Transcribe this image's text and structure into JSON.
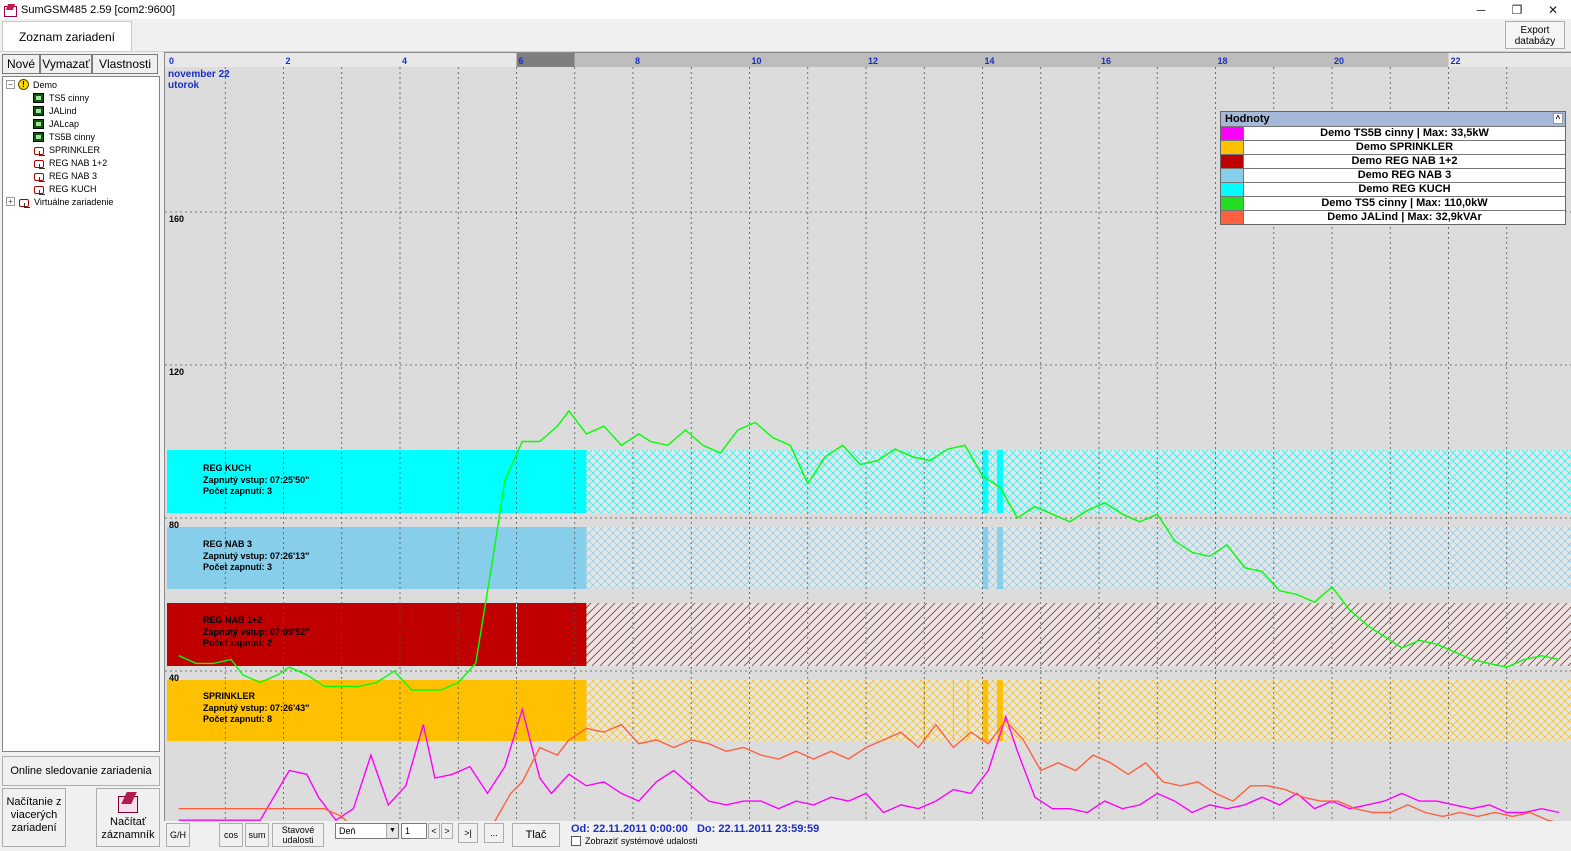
{
  "window": {
    "title": "SumGSM485 2.59 [com2:9600]",
    "minimize_glyph": "─",
    "restore_glyph": "❐",
    "close_glyph": "✕"
  },
  "toolbar": {
    "device_list_tab": "Zoznam zariadení",
    "export_line1": "Export",
    "export_line2": "databázy"
  },
  "left_panel": {
    "new_label": "Nové",
    "delete_label": "Vymazať",
    "properties_label": "Vlastnosti",
    "tree": {
      "root": "Demo",
      "expand_glyph": "−",
      "collapse_glyph": "+",
      "warning_glyph": "!",
      "children": [
        "TS5 cinny",
        "JALind",
        "JALcap",
        "TS5B cinny",
        "SPRINKLER",
        "REG NAB 1+2",
        "REG NAB 3",
        "REG KUCH"
      ],
      "child_icons": [
        "meter-icon",
        "meter-icon",
        "meter-icon",
        "meter-icon",
        "plug-icon",
        "plug-icon",
        "plug-icon",
        "plug-icon"
      ],
      "virtual": "Virtuálne zariadenie"
    },
    "online_label": "Online sledovanie zariadenia",
    "multi_line1": "Načítanie z",
    "multi_line2": "viacerých",
    "multi_line3": "zariadení",
    "record_line1": "Načítať",
    "record_line2": "záznamník"
  },
  "chart": {
    "header_date_line1": "november 22",
    "header_date_line2": "utorok",
    "colors": {
      "background": "#dcdcdc",
      "header_dark": "#7f7f7f",
      "ts5b": "#ff00ff",
      "sprinkler": "#ffc000",
      "reg_nab_12": "#c00000",
      "reg_nab_3": "#87ceeb",
      "reg_kuch": "#00ffff",
      "ts5": "#00ff00",
      "jalind": "#ff6040"
    },
    "bands": [
      {
        "name": "REG KUCH",
        "closed": "Zapnutý vstup: 07:25'50\"",
        "count": "Počet zapnutí: 3"
      },
      {
        "name": "REG NAB 3",
        "closed": "Zapnutý vstup: 07:26'13\"",
        "count": "Počet zapnutí: 3"
      },
      {
        "name": "REG NAB 1+2",
        "closed": "Zapnutý vstup: 07:09'52\"",
        "count": "Počet zapnutí: 2"
      },
      {
        "name": "SPRINKLER",
        "closed": "Zapnutý vstup: 07:26'43\"",
        "count": "Počet zapnutí: 8"
      }
    ],
    "legend": {
      "title": "Hodnoty",
      "close_glyph": "^",
      "rows": [
        {
          "label": "Demo TS5B cinny | Max: 33,5kW",
          "color": "#ff00ff"
        },
        {
          "label": "Demo SPRINKLER",
          "color": "#ffc000"
        },
        {
          "label": "Demo REG NAB 1+2",
          "color": "#c00000"
        },
        {
          "label": "Demo REG NAB 3",
          "color": "#87ceeb"
        },
        {
          "label": "Demo REG KUCH",
          "color": "#00ffff"
        },
        {
          "label": "Demo TS5 cinny | Max: 110,0kW",
          "color": "#22dd22"
        },
        {
          "label": "Demo JALind | Max: 32,9kVAr",
          "color": "#ff6040"
        }
      ]
    }
  },
  "chart_data": {
    "type": "line",
    "x_unit": "hour",
    "xlim": [
      0,
      24
    ],
    "x_ticks": [
      0,
      2,
      4,
      6,
      8,
      10,
      12,
      14,
      16,
      18,
      20,
      22
    ],
    "y_ticks": [
      40,
      80,
      120,
      160
    ],
    "grid": true,
    "legend_position": "top-right",
    "series": [
      {
        "name": "Demo TS5 cinny | Max: 110,0kW",
        "x": [
          0.2,
          0.5,
          0.8,
          1.1,
          1.3,
          1.6,
          1.9,
          2.1,
          2.4,
          2.7,
          3.0,
          3.3,
          3.6,
          3.9,
          4.2,
          4.4,
          4.7,
          5.0,
          5.3,
          5.6,
          5.8,
          6.1,
          6.4,
          6.7,
          6.9,
          7.2,
          7.5,
          7.8,
          8.1,
          8.3,
          8.6,
          8.9,
          9.2,
          9.5,
          9.8,
          10.1,
          10.4,
          10.7,
          11.0,
          11.3,
          11.6,
          11.9,
          12.2,
          12.5,
          12.8,
          13.1,
          13.4,
          13.7,
          14.0,
          14.3,
          14.6,
          14.9,
          15.2,
          15.5,
          15.8,
          16.1,
          16.4,
          16.7,
          17.0,
          17.3,
          17.6,
          17.9,
          18.2,
          18.5,
          18.8,
          19.1,
          19.4,
          19.7,
          20.0,
          20.3,
          20.6,
          20.9,
          21.2,
          21.5,
          21.8,
          22.1,
          22.4,
          22.7,
          23.0,
          23.3,
          23.6,
          23.9
        ],
        "values": [
          44,
          42,
          42,
          43,
          39,
          37,
          39,
          41,
          39,
          36,
          36,
          36,
          37,
          40,
          35,
          35,
          35,
          37,
          42,
          70,
          90,
          100,
          100,
          104,
          108,
          102,
          104,
          99,
          102,
          100,
          99,
          103,
          99,
          97,
          103,
          105,
          101,
          99,
          89,
          96,
          99,
          94,
          95,
          98,
          96,
          95,
          98,
          99,
          91,
          88,
          80,
          83,
          81,
          79,
          82,
          84,
          81,
          79,
          81,
          74,
          71,
          70,
          73,
          67,
          66,
          61,
          60,
          58,
          62,
          56,
          52,
          49,
          46,
          48,
          47,
          45,
          43,
          42,
          41,
          43,
          44,
          43
        ]
      },
      {
        "name": "Demo TS5B cinny | Max: 33,5kW",
        "x": [
          0.2,
          0.6,
          1.1,
          1.6,
          2.1,
          2.4,
          2.6,
          2.9,
          3.2,
          3.5,
          3.8,
          4.1,
          4.4,
          4.6,
          4.9,
          5.2,
          5.5,
          5.8,
          6.1,
          6.4,
          6.6,
          6.9,
          7.2,
          7.5,
          7.8,
          8.1,
          8.4,
          8.7,
          9.0,
          9.3,
          9.6,
          9.9,
          10.2,
          10.5,
          10.8,
          11.1,
          11.4,
          11.7,
          12.0,
          12.3,
          12.6,
          12.9,
          13.2,
          13.5,
          13.8,
          14.1,
          14.4,
          14.6,
          14.9,
          15.2,
          15.5,
          15.8,
          16.1,
          16.4,
          16.7,
          17.0,
          17.3,
          17.6,
          17.9,
          18.2,
          18.5,
          18.8,
          19.1,
          19.4,
          19.7,
          20.0,
          20.3,
          20.6,
          20.9,
          21.2,
          21.5,
          21.8,
          22.1,
          22.4,
          22.7,
          23.0,
          23.3,
          23.6,
          23.9
        ],
        "values": [
          1,
          1,
          1,
          1,
          14,
          13,
          7,
          1,
          4,
          18,
          5,
          10,
          26,
          12,
          13,
          15,
          8,
          15,
          30,
          12,
          8,
          13,
          10,
          11,
          8,
          6,
          11,
          14,
          10,
          6,
          5,
          6,
          6,
          4,
          6,
          5,
          7,
          6,
          8,
          3,
          5,
          4,
          6,
          9,
          8,
          14,
          28,
          19,
          7,
          4,
          4,
          3,
          6,
          4,
          5,
          8,
          6,
          3,
          5,
          4,
          5,
          7,
          5,
          8,
          4,
          6,
          4,
          5,
          6,
          8,
          6,
          6,
          5,
          4,
          5,
          3,
          3,
          4,
          3
        ]
      },
      {
        "name": "Demo JALind | Max: 32,9kVAr",
        "x": [
          0.2,
          0.8,
          1.6,
          2.4,
          2.7,
          3.0,
          3.3,
          3.6,
          4.0,
          4.4,
          4.7,
          5.0,
          5.3,
          5.6,
          5.9,
          6.1,
          6.4,
          6.7,
          6.9,
          7.2,
          7.5,
          7.8,
          8.1,
          8.4,
          8.7,
          9.0,
          9.3,
          9.6,
          9.9,
          10.2,
          10.5,
          10.8,
          11.1,
          11.4,
          11.7,
          12.0,
          12.3,
          12.6,
          12.9,
          13.2,
          13.5,
          13.8,
          14.1,
          14.4,
          14.7,
          15.0,
          15.3,
          15.6,
          15.9,
          16.2,
          16.5,
          16.8,
          17.1,
          17.4,
          17.7,
          18.0,
          18.3,
          18.6,
          18.9,
          19.2,
          19.5,
          19.8,
          20.1,
          20.4,
          20.7,
          21.0,
          21.3,
          21.6,
          21.9,
          22.2,
          22.5,
          22.8,
          23.1,
          23.4,
          23.7,
          24.0
        ],
        "values": [
          4,
          4,
          4,
          4,
          4,
          2,
          -3,
          -3,
          -3,
          -1,
          -3,
          -3,
          -3,
          0,
          8,
          11,
          20,
          18,
          22,
          25,
          24,
          26,
          21,
          22,
          20,
          22,
          21,
          19,
          20,
          18,
          17,
          19,
          17,
          19,
          17,
          20,
          22,
          24,
          20,
          26,
          20,
          24,
          21,
          27,
          22,
          14,
          16,
          14,
          18,
          16,
          13,
          16,
          11,
          10,
          11,
          8,
          6,
          10,
          10,
          9,
          7,
          6,
          6,
          4,
          3,
          3,
          5,
          3,
          2,
          3,
          2,
          3,
          2,
          3,
          1,
          0
        ]
      }
    ],
    "state_bands": [
      {
        "name": "REG KUCH",
        "on_hours": [
          [
            0,
            7.2
          ],
          [
            14.0,
            14.1
          ],
          [
            14.25,
            14.35
          ]
        ]
      },
      {
        "name": "REG NAB 3",
        "on_hours": [
          [
            0,
            7.2
          ],
          [
            14.0,
            14.1
          ],
          [
            14.25,
            14.35
          ]
        ]
      },
      {
        "name": "REG NAB 1+2",
        "on_hours": [
          [
            0,
            7.2
          ]
        ]
      },
      {
        "name": "SPRINKLER",
        "on_hours": [
          [
            0,
            7.2
          ],
          [
            14.0,
            14.1
          ],
          [
            14.25,
            14.35
          ]
        ]
      }
    ]
  },
  "bottom": {
    "gh_label": "G/H",
    "cos_label": "cos",
    "sum_label": "sum",
    "status_line1": "Stavové",
    "status_line2": "udalosti",
    "period_value": "Deň",
    "period_arrow": "▼",
    "num_value": "1",
    "prev_label": "<",
    "next_label": ">",
    "end_label": ">|",
    "more_label": "...",
    "print_label": "Tlač",
    "from_label": "Od: 22.11.2011 0:00:00",
    "to_label": "Do: 22.11.2011 23:59:59",
    "sys_events_label": "Zobraziť systémové udalosti"
  }
}
